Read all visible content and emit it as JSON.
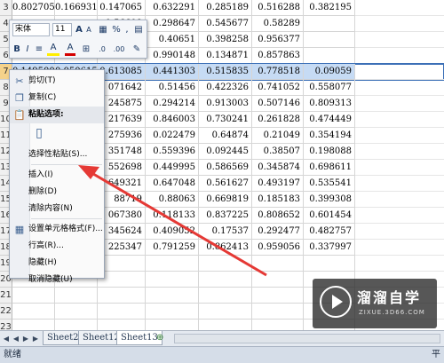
{
  "grid": {
    "rows": [
      {
        "num": "3",
        "cells": [
          "0.802705",
          "0.166931",
          "0.147065",
          "0.632291",
          "0.285189",
          "0.516288",
          "0.382195"
        ]
      },
      {
        "num": "4",
        "cells": [
          "",
          "",
          "0.56608",
          "0.298647",
          "0.545677",
          "0.58289",
          ""
        ]
      },
      {
        "num": "5",
        "cells": [
          "",
          "",
          "6196",
          "0.40651",
          "0.398258",
          "0.956377",
          ""
        ]
      },
      {
        "num": "6",
        "cells": [
          "",
          "",
          "0934",
          "0.990148",
          "0.134871",
          "0.857863",
          ""
        ]
      },
      {
        "num": "7",
        "cells": [
          "0.149500",
          "0.050615",
          "0.613085",
          "0.441303",
          "0.515835",
          "0.778518",
          "0.09059"
        ],
        "selected": true
      },
      {
        "num": "8",
        "cells": [
          "",
          "",
          "071642",
          "0.51456",
          "0.422326",
          "0.741052",
          "0.558077"
        ]
      },
      {
        "num": "9",
        "cells": [
          "",
          "",
          "245875",
          "0.294214",
          "0.913003",
          "0.507146",
          "0.809313"
        ]
      },
      {
        "num": "10",
        "cells": [
          "",
          "",
          "217639",
          "0.846003",
          "0.730241",
          "0.261828",
          "0.474449"
        ]
      },
      {
        "num": "11",
        "cells": [
          "",
          "",
          "275936",
          "0.022479",
          "0.64874",
          "0.21049",
          "0.354194"
        ]
      },
      {
        "num": "12",
        "cells": [
          "",
          "",
          "351748",
          "0.559396",
          "0.092445",
          "0.38507",
          "0.198088"
        ]
      },
      {
        "num": "13",
        "cells": [
          "",
          "",
          "552698",
          "0.449995",
          "0.586569",
          "0.345874",
          "0.698611"
        ]
      },
      {
        "num": "14",
        "cells": [
          "",
          "",
          "649321",
          "0.647048",
          "0.561627",
          "0.493197",
          "0.535541"
        ]
      },
      {
        "num": "15",
        "cells": [
          "",
          "",
          "88719",
          "0.88063",
          "0.669819",
          "0.185183",
          "0.399308"
        ]
      },
      {
        "num": "16",
        "cells": [
          "",
          "",
          "067380",
          "0.118133",
          "0.837225",
          "0.808652",
          "0.601454"
        ]
      },
      {
        "num": "17",
        "cells": [
          "",
          "",
          "345624",
          "0.409052",
          "0.17537",
          "0.292477",
          "0.482757"
        ]
      },
      {
        "num": "18",
        "cells": [
          "",
          "",
          "225347",
          "0.791259",
          "0.862413",
          "0.959056",
          "0.337997"
        ]
      },
      {
        "num": "19",
        "cells": [
          "",
          "",
          "",
          "",
          "",
          "",
          ""
        ]
      },
      {
        "num": "20",
        "cells": [
          "",
          "",
          "",
          "",
          "",
          "",
          ""
        ]
      },
      {
        "num": "21",
        "cells": [
          "",
          "",
          "",
          "",
          "",
          "",
          ""
        ]
      },
      {
        "num": "22",
        "cells": [
          "",
          "",
          "",
          "",
          "",
          "",
          ""
        ]
      },
      {
        "num": "23",
        "cells": [
          "",
          "",
          "",
          "",
          "",
          "",
          ""
        ]
      },
      {
        "num": "24",
        "cells": [
          "",
          "",
          "",
          "",
          "",
          "",
          ""
        ]
      }
    ]
  },
  "minibar": {
    "font": "宋体",
    "size": "11",
    "grow": "A",
    "shrink": "A",
    "percent": "%",
    "comma": ",",
    "bold": "B",
    "italic": "I",
    "align": "≡",
    "fill": "A",
    "font_color": "A",
    "dec_inc": ".0",
    "dec_dec": ".00"
  },
  "context_menu": {
    "items": [
      {
        "label": "剪切(T)",
        "icon": "scissors-icon"
      },
      {
        "label": "复制(C)",
        "icon": "copy-icon"
      },
      {
        "label": "粘贴选项:",
        "icon": "paste-options-icon",
        "header": true
      },
      {
        "label": "",
        "icon": "clipboard-icon"
      },
      {
        "label": "选择性粘贴(S)...",
        "icon": ""
      },
      {
        "label": "插入(I)",
        "icon": ""
      },
      {
        "label": "删除(D)",
        "icon": ""
      },
      {
        "label": "清除内容(N)",
        "icon": ""
      },
      {
        "label": "设置单元格格式(F)...",
        "icon": "format-cells-icon"
      },
      {
        "label": "行高(R)...",
        "icon": ""
      },
      {
        "label": "隐藏(H)",
        "icon": ""
      },
      {
        "label": "取消隐藏(U)",
        "icon": ""
      }
    ]
  },
  "sheets": {
    "tabs": [
      "Sheet2",
      "Sheet12",
      "Sheet13"
    ],
    "active": "Sheet13"
  },
  "status": {
    "text": "就绪",
    "right": "平"
  },
  "watermark": {
    "title": "溜溜自学",
    "url": "ZIXUE.3D66.COM"
  },
  "colors": {
    "arrow": "#e53935",
    "selection": "#c6dbf4",
    "header_selected": "#f5d28a"
  }
}
